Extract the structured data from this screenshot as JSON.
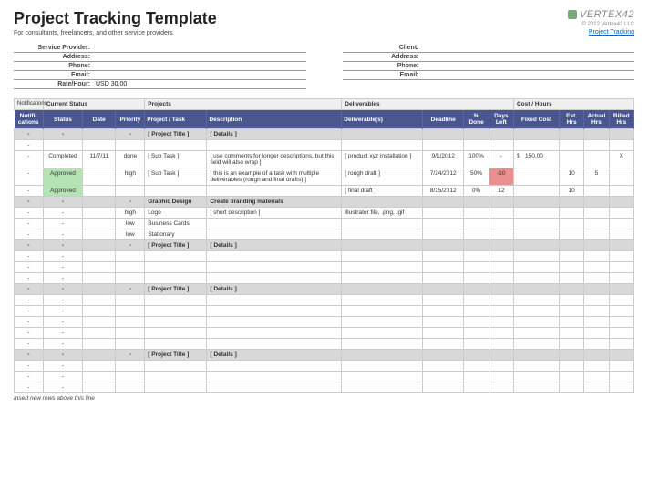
{
  "header": {
    "title": "Project Tracking Template",
    "subtitle": "For consultants, freelancers, and other service providers",
    "brand": "VERTEX42",
    "copyright": "© 2012 Vertex42 LLC",
    "link_text": "Project Tracking"
  },
  "info_left": {
    "l1": "Service Provider:",
    "v1": "",
    "l2": "Address:",
    "v2": "",
    "l3": "Phone:",
    "v3": "",
    "l4": "Email:",
    "v4": "",
    "l5": "Rate/Hour:",
    "v5": "USD 30.00"
  },
  "info_right": {
    "l1": "Client:",
    "v1": "",
    "l2": "Address:",
    "v2": "",
    "l3": "Phone:",
    "v3": "",
    "l4": "Email:",
    "v4": ""
  },
  "groups": {
    "g1_small": "Notifications",
    "g1": "Current Status",
    "g2": "Projects",
    "g3": "Deliverables",
    "g4": "Cost / Hours"
  },
  "cols": {
    "notif": "Notifi-cations",
    "status": "Status",
    "date": "Date",
    "priority": "Priority",
    "task": "Project / Task",
    "desc": "Description",
    "deliv": "Deliverable(s)",
    "deadline": "Deadline",
    "done": "% Done",
    "days": "Days Left",
    "cost": "Fixed Cost",
    "est": "Est. Hrs",
    "act": "Actual Hrs",
    "bill": "Billed Hrs"
  },
  "dash": "-",
  "section": {
    "pt": "[ Project Title ]",
    "det": "[ Details ]"
  },
  "rows": {
    "r1": {
      "status": "Completed",
      "date": "11/7/11",
      "priority": "done",
      "task": "[ Sub Task ]",
      "desc": "[ use comments for longer descriptions, but this field will also wrap ]",
      "deliv": "[ product xyz installation ]",
      "deadline": "9/1/2012",
      "done": "100%",
      "days": "-",
      "cost_cur": "$",
      "cost": "150.00",
      "bill": "X"
    },
    "r2": {
      "status": "Approved",
      "priority": "high",
      "task": "[ Sub Task ]",
      "desc": "[ this is an example of a task with multiple deliverables (rough and final drafts) ]",
      "deliv": "[ rough draft ]",
      "deadline": "7/24/2012",
      "done": "50%",
      "days": "-10",
      "est": "10",
      "act": "5"
    },
    "r3": {
      "status": "Approved",
      "deliv": "[ final draft ]",
      "deadline": "8/15/2012",
      "done": "0%",
      "days": "12",
      "est": "10"
    },
    "sec2_task": "Graphic Design",
    "sec2_desc": "Create branding materials",
    "r4": {
      "priority": "high",
      "task": "Logo",
      "desc": "[ short description ]",
      "deliv": "illustrator file, .png, .gif"
    },
    "r5": {
      "priority": "low",
      "task": "Business Cards"
    },
    "r6": {
      "priority": "low",
      "task": "Stationary"
    }
  },
  "footer": "Insert new rows above this line"
}
